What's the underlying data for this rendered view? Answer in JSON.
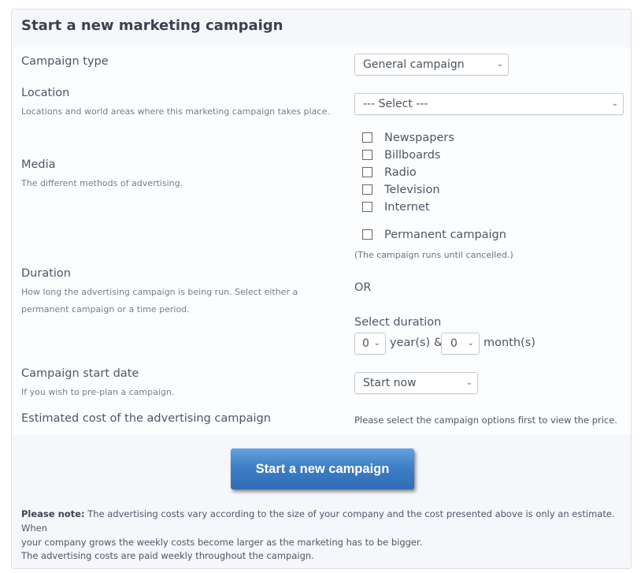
{
  "panel": {
    "title": "Start a new marketing campaign"
  },
  "form": {
    "campaign_type": {
      "label": "Campaign type",
      "selected": "General campaign"
    },
    "location": {
      "label": "Location",
      "description": "Locations and world areas where this marketing campaign takes place.",
      "selected": "--- Select ---"
    },
    "media": {
      "label": "Media",
      "description": "The different methods of advertising.",
      "options": [
        {
          "label": "Newspapers",
          "checked": false
        },
        {
          "label": "Billboards",
          "checked": false
        },
        {
          "label": "Radio",
          "checked": false
        },
        {
          "label": "Television",
          "checked": false
        },
        {
          "label": "Internet",
          "checked": false
        }
      ]
    },
    "duration": {
      "label": "Duration",
      "description_line1": "How long the advertising campaign is being run. Select either a",
      "description_line2": "permanent campaign or a time period.",
      "permanent_label": "Permanent campaign",
      "permanent_checked": false,
      "permanent_note": "(The campaign runs until cancelled.)",
      "or_text": "OR",
      "select_duration_label": "Select duration",
      "years_value": "0",
      "years_unit": "year(s) &",
      "months_value": "0",
      "months_unit": "month(s)"
    },
    "start_date": {
      "label": "Campaign start date",
      "description": "If you wish to pre-plan a campaign.",
      "selected": "Start now"
    },
    "estimated_cost": {
      "label": "Estimated cost of the advertising campaign",
      "value": "Please select the campaign options first to view the price."
    }
  },
  "footer": {
    "submit_label": "Start a new campaign",
    "note_bold": "Please note:",
    "note_line1": " The advertising costs vary according to the size of your company and the cost presented above is only an estimate. When",
    "note_line2": "your company grows the weekly costs become larger as the marketing has to be bigger.",
    "note_paid": "The advertising costs are paid weekly throughout the campaign."
  },
  "icons": {
    "chevron": "⌄"
  }
}
